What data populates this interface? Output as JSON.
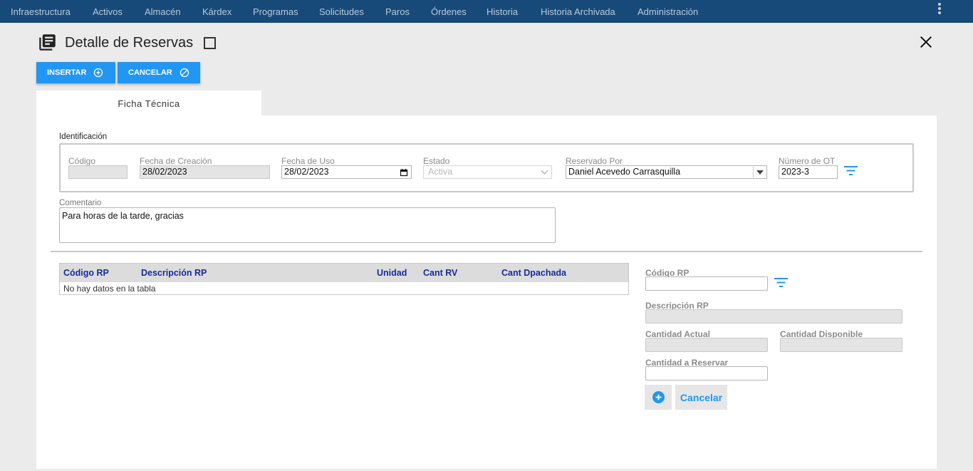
{
  "nav": {
    "items": [
      {
        "label": "Infraestructura"
      },
      {
        "label": "Activos"
      },
      {
        "label": "Almacén"
      },
      {
        "label": "Kárdex"
      },
      {
        "label": "Programas"
      },
      {
        "label": "Solicitudes"
      },
      {
        "label": "Paros"
      },
      {
        "label": "Órdenes"
      },
      {
        "label": "Historia"
      },
      {
        "label": "Historia Archivada"
      },
      {
        "label": "Administración"
      }
    ],
    "menu_icon": "more-vert-icon"
  },
  "header": {
    "title": "Detalle de Reservas",
    "icon": "library-books-icon",
    "close_icon": "close-icon"
  },
  "toolbar": {
    "insert_label": "INSERTAR",
    "insert_icon": "add-circle-icon",
    "cancel_label": "CANCELAR",
    "cancel_icon": "block-icon"
  },
  "tabs": [
    {
      "label": "Ficha Técnica",
      "active": true
    }
  ],
  "identificacion": {
    "label": "Identificación",
    "codigo": {
      "label": "Código",
      "value": ""
    },
    "fecha_creacion": {
      "label": "Fecha de Creación",
      "value": "28/02/2023"
    },
    "fecha_uso": {
      "label": "Fecha de Uso",
      "value": "28/02/2023"
    },
    "estado": {
      "label": "Estado",
      "value": "Activa"
    },
    "reservado_por": {
      "label": "Reservado Por",
      "value": "Daniel Acevedo Carrasquilla"
    },
    "numero_ot": {
      "label": "Número de OT",
      "value": "2023-3"
    }
  },
  "comentario": {
    "label": "Comentario",
    "value": "Para horas de la tarde, gracias"
  },
  "table": {
    "columns": [
      "Código RP",
      "Descripción RP",
      "Unidad",
      "Cant RV",
      "Cant Dpachada"
    ],
    "rows": [],
    "empty_text": "No hay datos en la tabla"
  },
  "detail_form": {
    "codigo_rp": {
      "label": "Código RP",
      "value": ""
    },
    "descripcion_rp": {
      "label": "Descripción RP",
      "value": ""
    },
    "cantidad_actual": {
      "label": "Cantidad Actual",
      "value": ""
    },
    "cantidad_disponible": {
      "label": "Cantidad Disponible",
      "value": ""
    },
    "cantidad_reservar": {
      "label": "Cantidad a Reservar",
      "value": ""
    },
    "add_icon": "add-circle-icon",
    "cancel_label": "Cancelar"
  },
  "colors": {
    "nav_bg": "#174a78",
    "accent": "#2196f3",
    "table_header_text": "#1a2a9a"
  }
}
